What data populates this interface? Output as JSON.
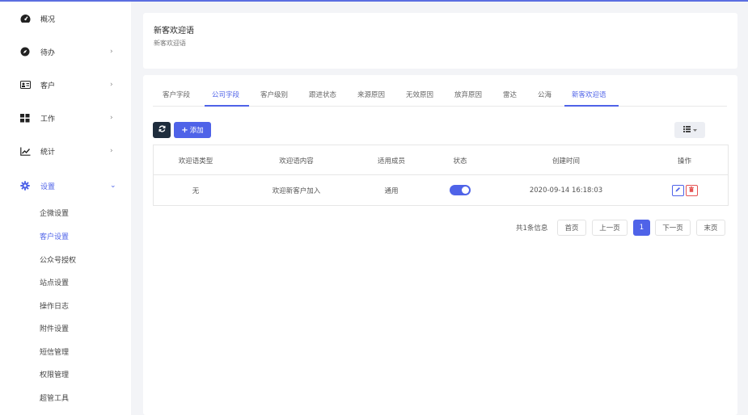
{
  "sidebar": {
    "items": [
      {
        "label": "概况",
        "icon": "dashboard-icon",
        "has_chevron": false
      },
      {
        "label": "待办",
        "icon": "compass-icon",
        "has_chevron": true
      },
      {
        "label": "客户",
        "icon": "id-card-icon",
        "has_chevron": true
      },
      {
        "label": "工作",
        "icon": "grid-icon",
        "has_chevron": true
      },
      {
        "label": "统计",
        "icon": "line-chart-icon",
        "has_chevron": true
      },
      {
        "label": "设置",
        "icon": "gear-icon",
        "has_chevron": true,
        "expanded": true
      }
    ],
    "sub_items": [
      "企微设置",
      "客户设置",
      "公众号授权",
      "站点设置",
      "操作日志",
      "附件设置",
      "短信管理",
      "权限管理",
      "超管工具"
    ],
    "active_sub": "客户设置",
    "chevron_right": "›",
    "chevron_down": "⌄"
  },
  "header": {
    "title": "新客欢迎语",
    "subtitle": "新客欢迎语"
  },
  "tabs": {
    "items": [
      "客户字段",
      "公司字段",
      "客户级别",
      "跟进状态",
      "来源原因",
      "无效原因",
      "放弃原因",
      "雷达",
      "公海",
      "新客欢迎语"
    ],
    "active": "新客欢迎语",
    "underlined": "公司字段"
  },
  "toolbar": {
    "add_label": "添加",
    "add_prefix": "+"
  },
  "table": {
    "columns": [
      "欢迎语类型",
      "欢迎语内容",
      "适用成员",
      "状态",
      "创建时间",
      "操作"
    ],
    "rows": [
      {
        "type": "无",
        "content": "欢迎新客户加入",
        "members": "通用",
        "status_on": true,
        "created": "2020-09-14 16:18:03"
      }
    ]
  },
  "pagination": {
    "info": "共1条信息",
    "first": "首页",
    "prev": "上一页",
    "current": "1",
    "next": "下一页",
    "last": "末页"
  },
  "colors": {
    "accent": "#4f63e8",
    "dark_button": "#1f2d3d",
    "danger": "#e55353"
  }
}
